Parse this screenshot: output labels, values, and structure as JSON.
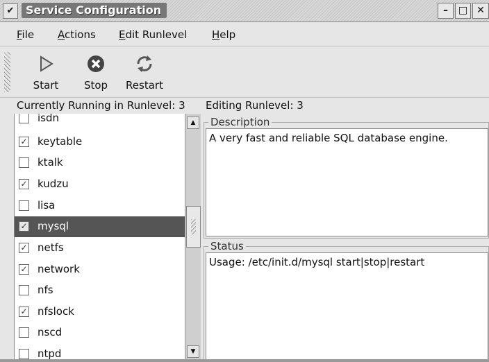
{
  "window": {
    "title": "Service Configuration",
    "menu_glyph": "✔",
    "minimize": "–",
    "maximize": "□",
    "close": "✕"
  },
  "menu": [
    {
      "pre": "",
      "ul": "F",
      "post": "ile"
    },
    {
      "pre": "",
      "ul": "A",
      "post": "ctions"
    },
    {
      "pre": "",
      "ul": "E",
      "post": "dit Runlevel"
    },
    {
      "pre": "",
      "ul": "H",
      "post": "elp"
    }
  ],
  "toolbar": {
    "start": "Start",
    "stop": "Stop",
    "restart": "Restart"
  },
  "status": {
    "running": "Currently Running in Runlevel: 3",
    "editing": "Editing Runlevel: 3"
  },
  "services": [
    {
      "name": "isdn",
      "checked": false
    },
    {
      "name": "keytable",
      "checked": true
    },
    {
      "name": "ktalk",
      "checked": false
    },
    {
      "name": "kudzu",
      "checked": true
    },
    {
      "name": "lisa",
      "checked": false
    },
    {
      "name": "mysql",
      "checked": true,
      "selected": true
    },
    {
      "name": "netfs",
      "checked": true
    },
    {
      "name": "network",
      "checked": true
    },
    {
      "name": "nfs",
      "checked": false
    },
    {
      "name": "nfslock",
      "checked": true
    },
    {
      "name": "nscd",
      "checked": false
    },
    {
      "name": "ntpd",
      "checked": false
    }
  ],
  "description": {
    "label": "Description",
    "text": "A very fast and reliable SQL database engine."
  },
  "status_panel": {
    "label": "Status",
    "text": "Usage: /etc/init.d/mysql start|stop|restart"
  },
  "scroll": {
    "up": "▲",
    "down": "▼"
  },
  "check_glyph": "✓"
}
